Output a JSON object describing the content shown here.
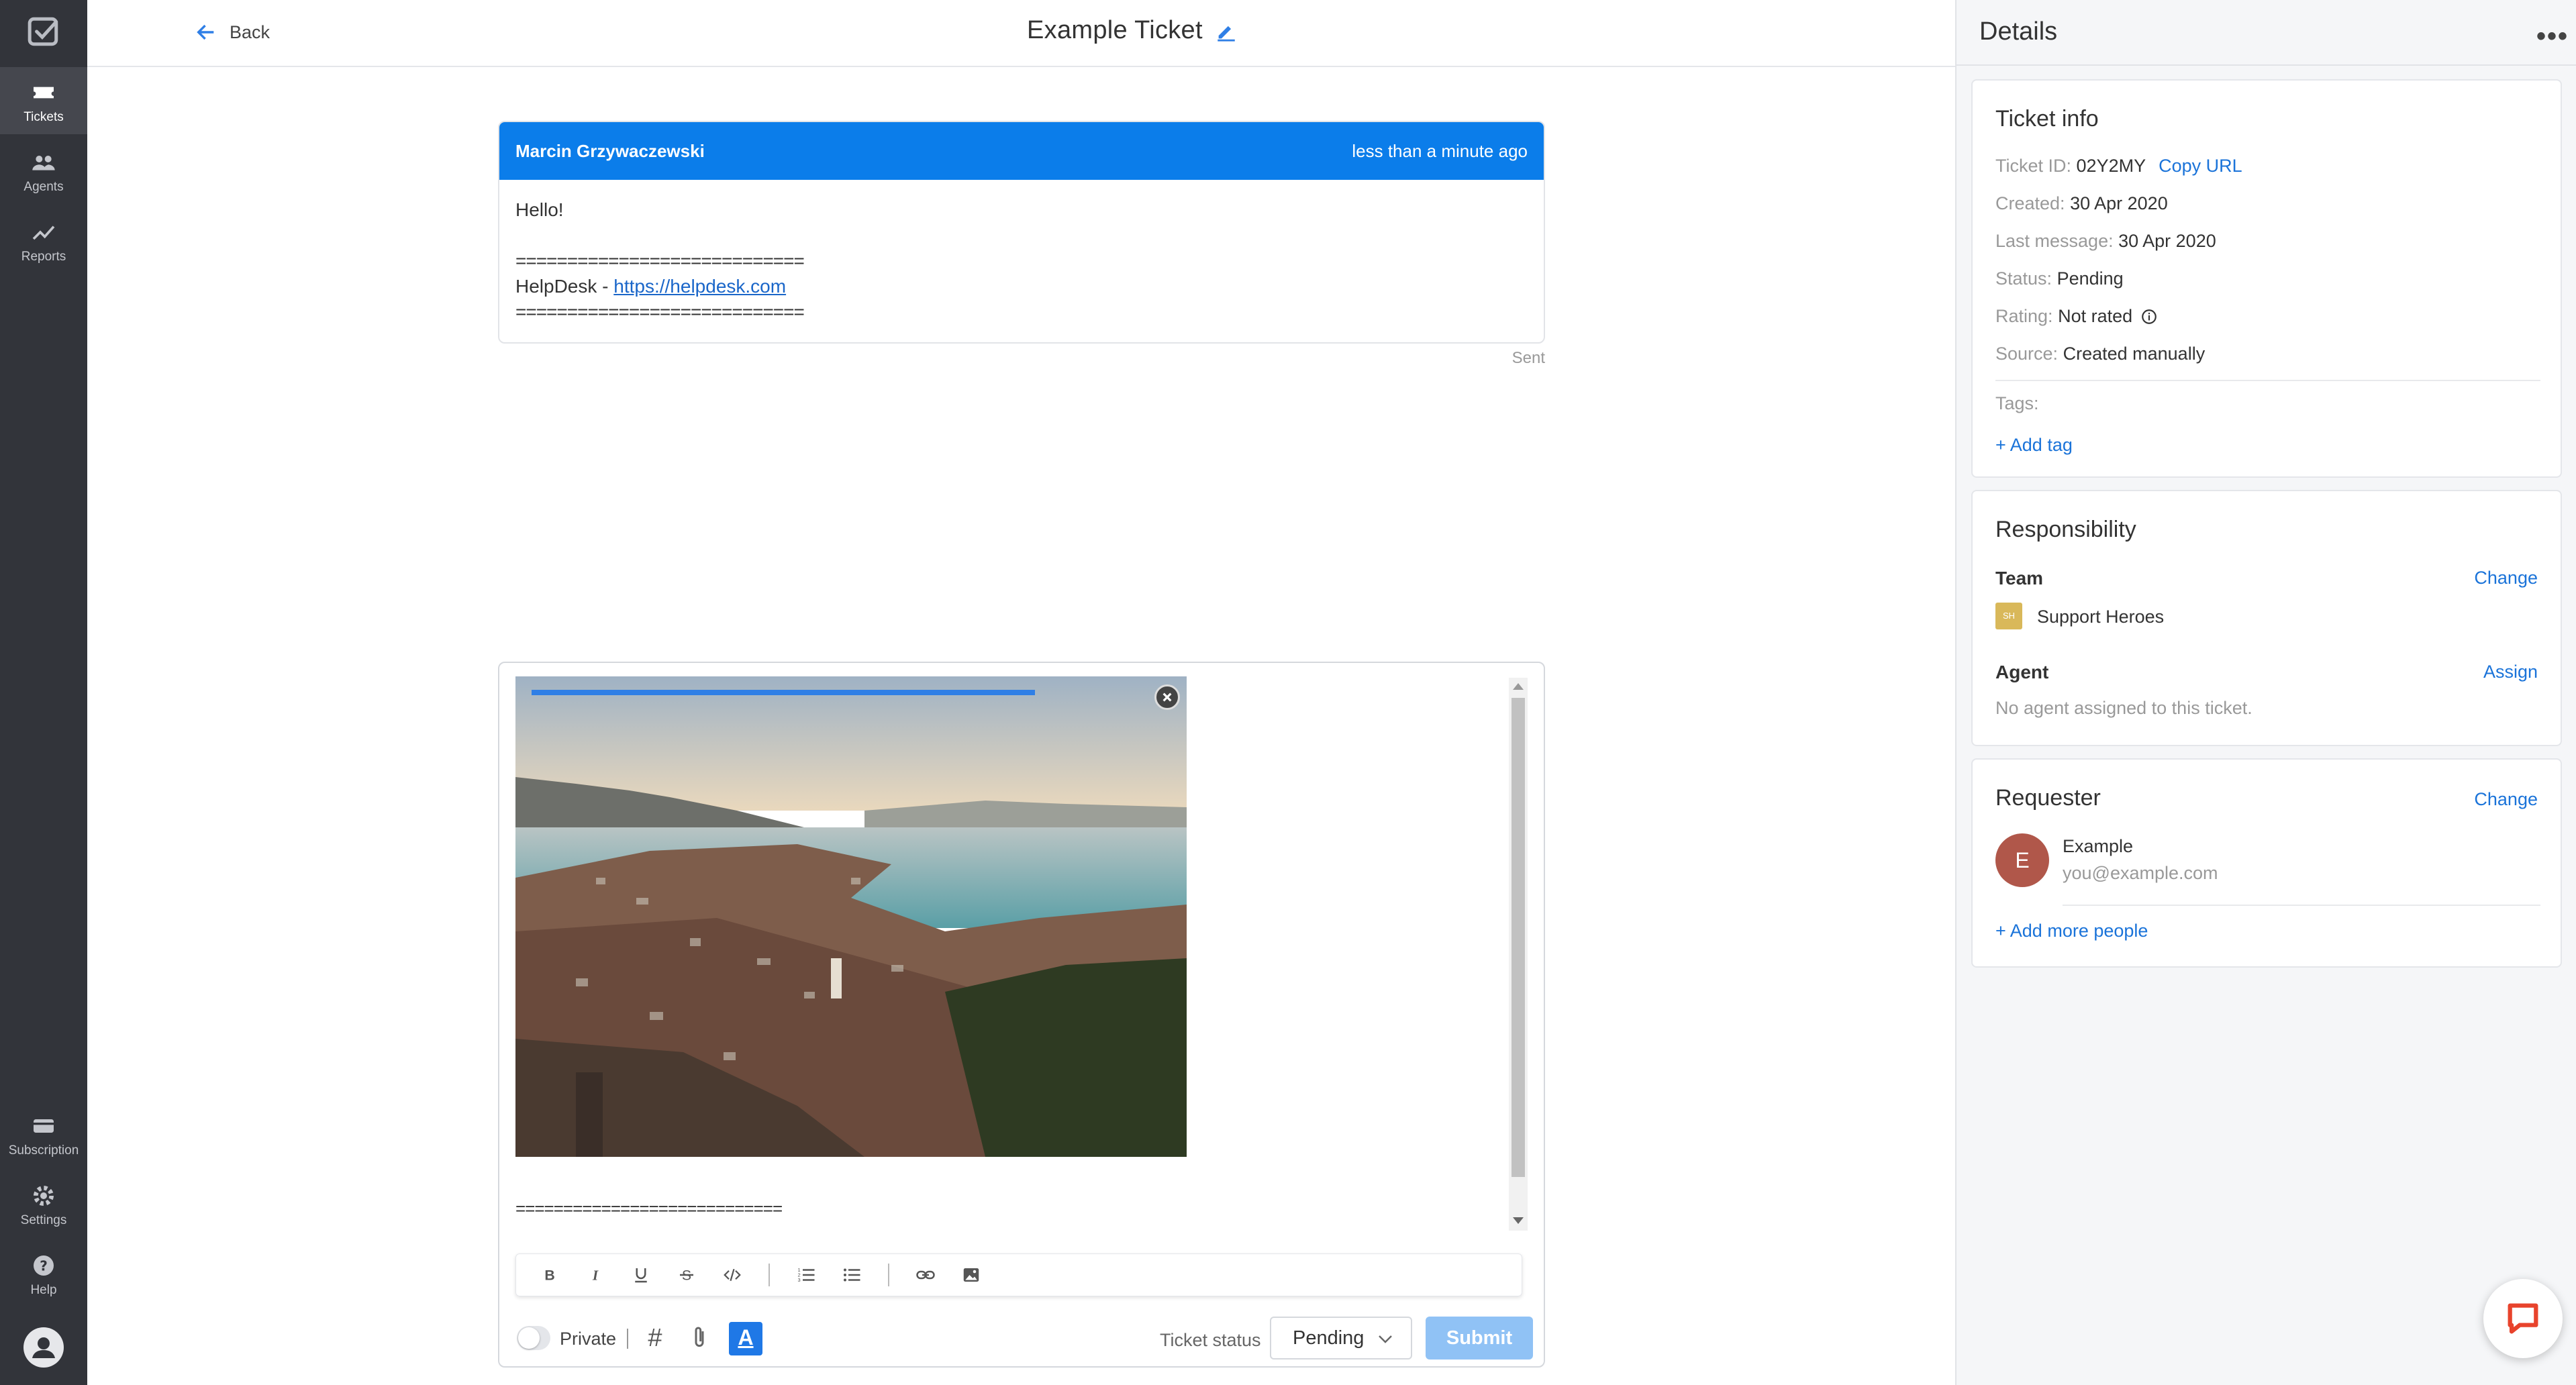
{
  "nav": {
    "items": [
      {
        "label": "Tickets",
        "icon": "ticket-icon",
        "active": true
      },
      {
        "label": "Agents",
        "icon": "agents-icon"
      },
      {
        "label": "Reports",
        "icon": "reports-icon"
      }
    ],
    "bottom_items": [
      {
        "label": "Subscription",
        "icon": "card-icon"
      },
      {
        "label": "Settings",
        "icon": "gear-icon"
      },
      {
        "label": "Help",
        "icon": "help-icon"
      }
    ]
  },
  "header": {
    "back_label": "Back",
    "title": "Example Ticket"
  },
  "message": {
    "author": "Marcin Grzywaczewski",
    "time": "less than a minute ago",
    "greeting": "Hello!",
    "divider": "============================",
    "signature_prefix": "HelpDesk - ",
    "signature_link": "https://helpdesk.com",
    "status": "Sent"
  },
  "editor": {
    "upload_progress": 0.75,
    "trailing_divider": "============================",
    "private_label": "Private",
    "ticket_status_label": "Ticket status",
    "ticket_status_value": "Pending",
    "submit_label": "Submit",
    "font_button": "A",
    "hash_symbol": "#",
    "format_buttons": [
      "bold",
      "italic",
      "underline",
      "strikethrough",
      "code",
      "ordered-list",
      "bullet-list",
      "link",
      "image"
    ]
  },
  "details": {
    "title": "Details",
    "more": "•••",
    "ticket_info": {
      "title": "Ticket info",
      "ticket_id_label": "Ticket ID:",
      "ticket_id": "02Y2MY",
      "copy_url": "Copy URL",
      "created_label": "Created:",
      "created": "30 Apr 2020",
      "last_message_label": "Last message:",
      "last_message": "30 Apr 2020",
      "status_label": "Status:",
      "status": "Pending",
      "rating_label": "Rating:",
      "rating": "Not rated",
      "source_label": "Source:",
      "source": "Created manually",
      "tags_label": "Tags:",
      "add_tag": "+ Add tag"
    },
    "responsibility": {
      "title": "Responsibility",
      "team_label": "Team",
      "team_change": "Change",
      "team_badge": "SH",
      "team_name": "Support Heroes",
      "agent_label": "Agent",
      "agent_assign": "Assign",
      "agent_none": "No agent assigned to this ticket."
    },
    "requester": {
      "title": "Requester",
      "change": "Change",
      "avatar_letter": "E",
      "name": "Example",
      "email": "you@example.com",
      "add_more": "+ Add more people"
    }
  },
  "colors": {
    "nav_bg": "#32343a",
    "accent": "#0b7dea",
    "link": "#1a73d9",
    "submit_disabled": "#90c2f5",
    "chat_icon": "#e8432c"
  }
}
